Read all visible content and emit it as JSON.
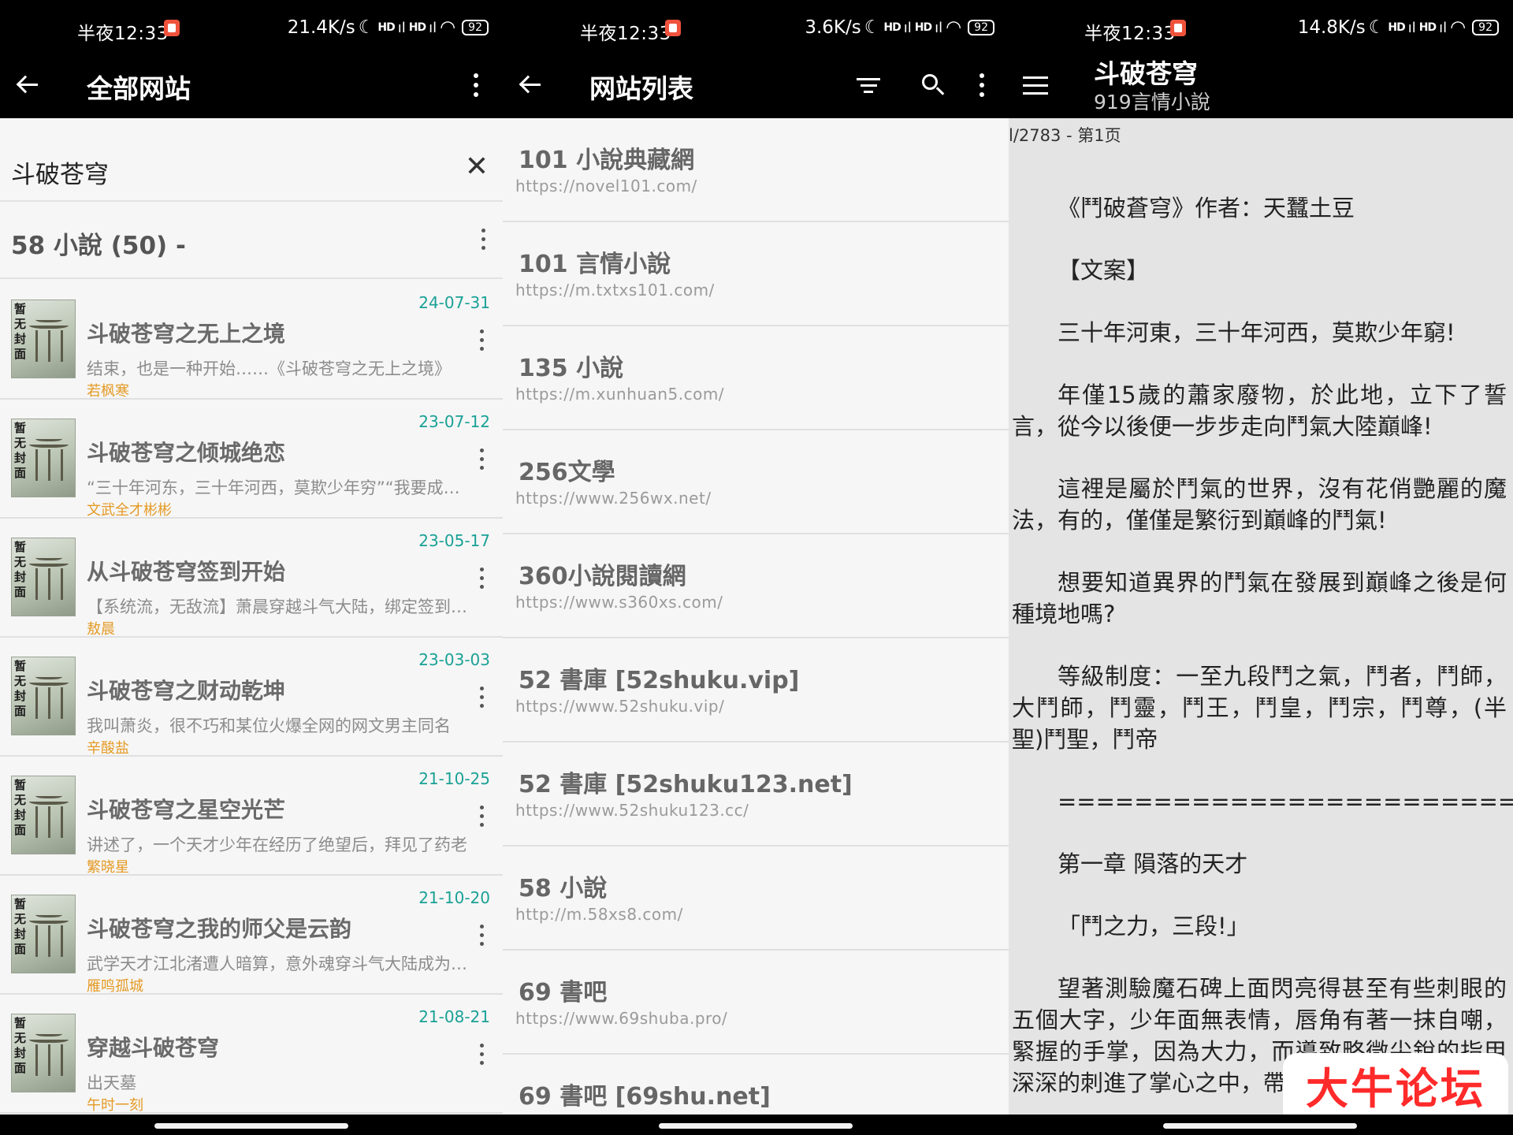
{
  "status": [
    {
      "time": "半夜12:33",
      "speed": "21.4K/s",
      "signal1": "HD",
      "signal2": "HD",
      "battery": "92"
    },
    {
      "time": "半夜12:33",
      "speed": "3.6K/s",
      "signal1": "HD",
      "signal2": "HD",
      "battery": "92"
    },
    {
      "time": "半夜12:33",
      "speed": "14.8K/s",
      "signal1": "HD",
      "signal2": "HD",
      "battery": "92"
    }
  ],
  "panel1": {
    "title": "全部网站",
    "search_value": "斗破苍穹",
    "group_header": "58 小說 (50) -",
    "cover_text": "暂无封面",
    "books": [
      {
        "date": "24-07-31",
        "name": "斗破苍穹之无上之境",
        "desc": "结束，也是一种开始……《斗破苍穹之无上之境》",
        "author": "若枫寒"
      },
      {
        "date": "23-07-12",
        "name": "斗破苍穹之倾城绝恋",
        "desc": "“三十年河东，三十年河西，莫欺少年穷”“我要成为斗帝”",
        "author": "文武全才彬彬"
      },
      {
        "date": "23-05-17",
        "name": "从斗破苍穹签到开始",
        "desc": "【系统流，无敌流】萧晨穿越斗气大陆，绑定签到系统",
        "author": "敖晨"
      },
      {
        "date": "23-03-03",
        "name": "斗破苍穹之财动乾坤",
        "desc": "我叫萧炎，很不巧和某位火爆全网的网文男主同名",
        "author": "辛酸盐"
      },
      {
        "date": "21-10-25",
        "name": "斗破苍穹之星空光芒",
        "desc": "讲述了，一个天才少年在经历了绝望后，拜见了药老",
        "author": "繁晓星"
      },
      {
        "date": "21-10-20",
        "name": "斗破苍穹之我的师父是云韵",
        "desc": "武学天才江北渚遭人暗算，意外魂穿斗气大陆成为萧炎",
        "author": "雁鸣孤城"
      },
      {
        "date": "21-08-21",
        "name": "穿越斗破苍穹",
        "desc": "出天墓",
        "author": "午时一刻"
      }
    ]
  },
  "panel2": {
    "title": "网站列表",
    "sites": [
      {
        "name": "101 小說典藏網",
        "url": "https://novel101.com/"
      },
      {
        "name": "101 言情小說",
        "url": "https://m.txtxs101.com/"
      },
      {
        "name": "135 小說",
        "url": "https://m.xunhuan5.com/"
      },
      {
        "name": "256文學",
        "url": "https://www.256wx.net/"
      },
      {
        "name": "360小說閱讀網",
        "url": "https://www.s360xs.com/"
      },
      {
        "name": "52 書庫 [52shuku.vip]",
        "url": "https://www.52shuku.vip/"
      },
      {
        "name": "52 書庫 [52shuku123.net]",
        "url": "https://www.52shuku123.cc/"
      },
      {
        "name": "58 小說",
        "url": "http://m.58xs8.com/"
      },
      {
        "name": "69 書吧",
        "url": "https://www.69shuba.pro/"
      },
      {
        "name": "69 書吧 [69shu.net]",
        "url": ""
      }
    ]
  },
  "panel3": {
    "title": "斗破苍穹",
    "subtitle": "919言情小說",
    "page_info": "l/2783 - 第1页",
    "paragraphs": [
      "《鬥破蒼穹》作者：天蠶土豆",
      "【文案】",
      "三十年河東，三十年河西，莫欺少年窮!",
      "年僅15歲的蕭家廢物，於此地，立下了誓言，從今以後便一步步走向鬥氣大陸巔峰!",
      "這裡是屬於鬥氣的世界，沒有花俏艷麗的魔法，有的，僅僅是繁衍到巔峰的鬥氣!",
      "想要知道異界的鬥氣在發展到巔峰之後是何種境地嗎?",
      "等級制度：一至九段鬥之氣，鬥者，鬥師，大鬥師，鬥靈，鬥王，鬥皇，鬥宗，鬥尊，(半聖)鬥聖，鬥帝",
      "========================",
      "第一章 隕落的天才",
      "「鬥之力，三段!」",
      "望著測驗魔石碑上面閃亮得甚至有些刺眼的五個大字，少年面無表情，唇角有著一抹自嘲，緊握的手掌，因為大力，而導致略微尖銳的指甲深深的刺進了掌心之中，帶來一陣陣鑽心的疼痛"
    ]
  },
  "watermark": "大牛论坛",
  "colors": {
    "accent_date": "#1aa196",
    "author": "#e49a25",
    "watermark": "#ff2a2a"
  }
}
